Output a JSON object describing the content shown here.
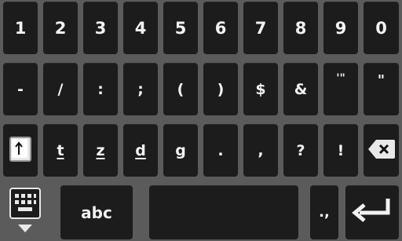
{
  "keyboard": {
    "row1": [
      "1",
      "2",
      "3",
      "4",
      "5",
      "6",
      "7",
      "8",
      "9",
      "0"
    ],
    "row2": [
      "-",
      "/",
      ":",
      ";",
      "(",
      ")",
      "$",
      "&",
      "'\"",
      "\""
    ],
    "row3": [
      "t",
      "z",
      "d",
      "g",
      ".",
      ",",
      "?",
      "!"
    ],
    "row4": {
      "abc_label": "abc",
      "punct_label": ".,"
    },
    "icons": {
      "shift": "shift-arrow-icon",
      "backspace": "backspace-x-icon",
      "hide_keyboard": "keyboard-hide-icon",
      "enter": "enter-return-icon"
    },
    "colors": {
      "background": "#5b5b5b",
      "key": "#1c1c1c",
      "text": "#f2f2f2"
    }
  }
}
